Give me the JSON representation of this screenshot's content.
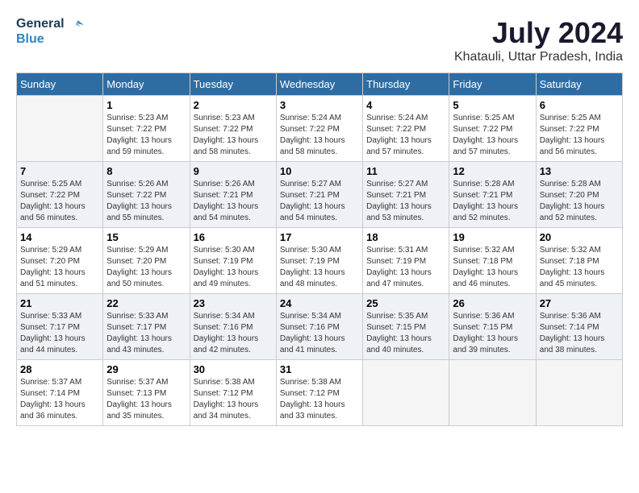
{
  "header": {
    "logo_line1": "General",
    "logo_line2": "Blue",
    "month": "July 2024",
    "location": "Khatauli, Uttar Pradesh, India"
  },
  "weekdays": [
    "Sunday",
    "Monday",
    "Tuesday",
    "Wednesday",
    "Thursday",
    "Friday",
    "Saturday"
  ],
  "weeks": [
    [
      {
        "day": "",
        "empty": true
      },
      {
        "day": "1",
        "sunrise": "5:23 AM",
        "sunset": "7:22 PM",
        "daylight": "13 hours and 59 minutes."
      },
      {
        "day": "2",
        "sunrise": "5:23 AM",
        "sunset": "7:22 PM",
        "daylight": "13 hours and 58 minutes."
      },
      {
        "day": "3",
        "sunrise": "5:24 AM",
        "sunset": "7:22 PM",
        "daylight": "13 hours and 58 minutes."
      },
      {
        "day": "4",
        "sunrise": "5:24 AM",
        "sunset": "7:22 PM",
        "daylight": "13 hours and 57 minutes."
      },
      {
        "day": "5",
        "sunrise": "5:25 AM",
        "sunset": "7:22 PM",
        "daylight": "13 hours and 57 minutes."
      },
      {
        "day": "6",
        "sunrise": "5:25 AM",
        "sunset": "7:22 PM",
        "daylight": "13 hours and 56 minutes."
      }
    ],
    [
      {
        "day": "7",
        "sunrise": "5:25 AM",
        "sunset": "7:22 PM",
        "daylight": "13 hours and 56 minutes."
      },
      {
        "day": "8",
        "sunrise": "5:26 AM",
        "sunset": "7:22 PM",
        "daylight": "13 hours and 55 minutes."
      },
      {
        "day": "9",
        "sunrise": "5:26 AM",
        "sunset": "7:21 PM",
        "daylight": "13 hours and 54 minutes."
      },
      {
        "day": "10",
        "sunrise": "5:27 AM",
        "sunset": "7:21 PM",
        "daylight": "13 hours and 54 minutes."
      },
      {
        "day": "11",
        "sunrise": "5:27 AM",
        "sunset": "7:21 PM",
        "daylight": "13 hours and 53 minutes."
      },
      {
        "day": "12",
        "sunrise": "5:28 AM",
        "sunset": "7:21 PM",
        "daylight": "13 hours and 52 minutes."
      },
      {
        "day": "13",
        "sunrise": "5:28 AM",
        "sunset": "7:20 PM",
        "daylight": "13 hours and 52 minutes."
      }
    ],
    [
      {
        "day": "14",
        "sunrise": "5:29 AM",
        "sunset": "7:20 PM",
        "daylight": "13 hours and 51 minutes."
      },
      {
        "day": "15",
        "sunrise": "5:29 AM",
        "sunset": "7:20 PM",
        "daylight": "13 hours and 50 minutes."
      },
      {
        "day": "16",
        "sunrise": "5:30 AM",
        "sunset": "7:19 PM",
        "daylight": "13 hours and 49 minutes."
      },
      {
        "day": "17",
        "sunrise": "5:30 AM",
        "sunset": "7:19 PM",
        "daylight": "13 hours and 48 minutes."
      },
      {
        "day": "18",
        "sunrise": "5:31 AM",
        "sunset": "7:19 PM",
        "daylight": "13 hours and 47 minutes."
      },
      {
        "day": "19",
        "sunrise": "5:32 AM",
        "sunset": "7:18 PM",
        "daylight": "13 hours and 46 minutes."
      },
      {
        "day": "20",
        "sunrise": "5:32 AM",
        "sunset": "7:18 PM",
        "daylight": "13 hours and 45 minutes."
      }
    ],
    [
      {
        "day": "21",
        "sunrise": "5:33 AM",
        "sunset": "7:17 PM",
        "daylight": "13 hours and 44 minutes."
      },
      {
        "day": "22",
        "sunrise": "5:33 AM",
        "sunset": "7:17 PM",
        "daylight": "13 hours and 43 minutes."
      },
      {
        "day": "23",
        "sunrise": "5:34 AM",
        "sunset": "7:16 PM",
        "daylight": "13 hours and 42 minutes."
      },
      {
        "day": "24",
        "sunrise": "5:34 AM",
        "sunset": "7:16 PM",
        "daylight": "13 hours and 41 minutes."
      },
      {
        "day": "25",
        "sunrise": "5:35 AM",
        "sunset": "7:15 PM",
        "daylight": "13 hours and 40 minutes."
      },
      {
        "day": "26",
        "sunrise": "5:36 AM",
        "sunset": "7:15 PM",
        "daylight": "13 hours and 39 minutes."
      },
      {
        "day": "27",
        "sunrise": "5:36 AM",
        "sunset": "7:14 PM",
        "daylight": "13 hours and 38 minutes."
      }
    ],
    [
      {
        "day": "28",
        "sunrise": "5:37 AM",
        "sunset": "7:14 PM",
        "daylight": "13 hours and 36 minutes."
      },
      {
        "day": "29",
        "sunrise": "5:37 AM",
        "sunset": "7:13 PM",
        "daylight": "13 hours and 35 minutes."
      },
      {
        "day": "30",
        "sunrise": "5:38 AM",
        "sunset": "7:12 PM",
        "daylight": "13 hours and 34 minutes."
      },
      {
        "day": "31",
        "sunrise": "5:38 AM",
        "sunset": "7:12 PM",
        "daylight": "13 hours and 33 minutes."
      },
      {
        "day": "",
        "empty": true
      },
      {
        "day": "",
        "empty": true
      },
      {
        "day": "",
        "empty": true
      }
    ]
  ],
  "row_bg": [
    "#ffffff",
    "#eef2f7",
    "#ffffff",
    "#eef2f7",
    "#ffffff"
  ]
}
